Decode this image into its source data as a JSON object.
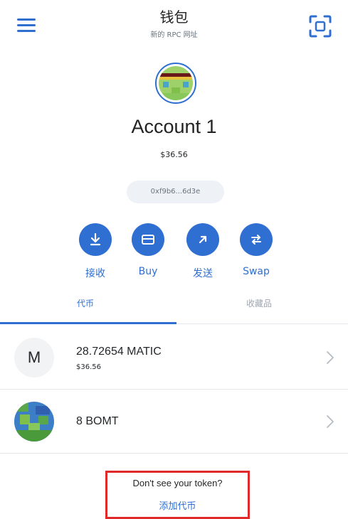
{
  "header": {
    "title": "钱包",
    "subtitle": "新的 RPC 网址"
  },
  "account": {
    "name": "Account 1",
    "balance": "$36.56",
    "address": "0xf9b6...6d3e"
  },
  "actions": [
    {
      "label": "接收",
      "icon": "download-icon"
    },
    {
      "label": "Buy",
      "icon": "card-icon"
    },
    {
      "label": "发送",
      "icon": "arrow-up-right-icon"
    },
    {
      "label": "Swap",
      "icon": "swap-icon"
    }
  ],
  "tabs": {
    "tokens": "代币",
    "collectibles": "收藏品"
  },
  "tokens": [
    {
      "amount": "28.72654 MATIC",
      "fiat": "$36.56",
      "icon_letter": "M"
    },
    {
      "amount": "8 BOMT",
      "fiat": ""
    }
  ],
  "footer": {
    "prompt": "Don't see your token?",
    "add_link": "添加代币"
  },
  "colors": {
    "accent": "#2f6fd1",
    "highlight_border": "#e02a2a"
  }
}
